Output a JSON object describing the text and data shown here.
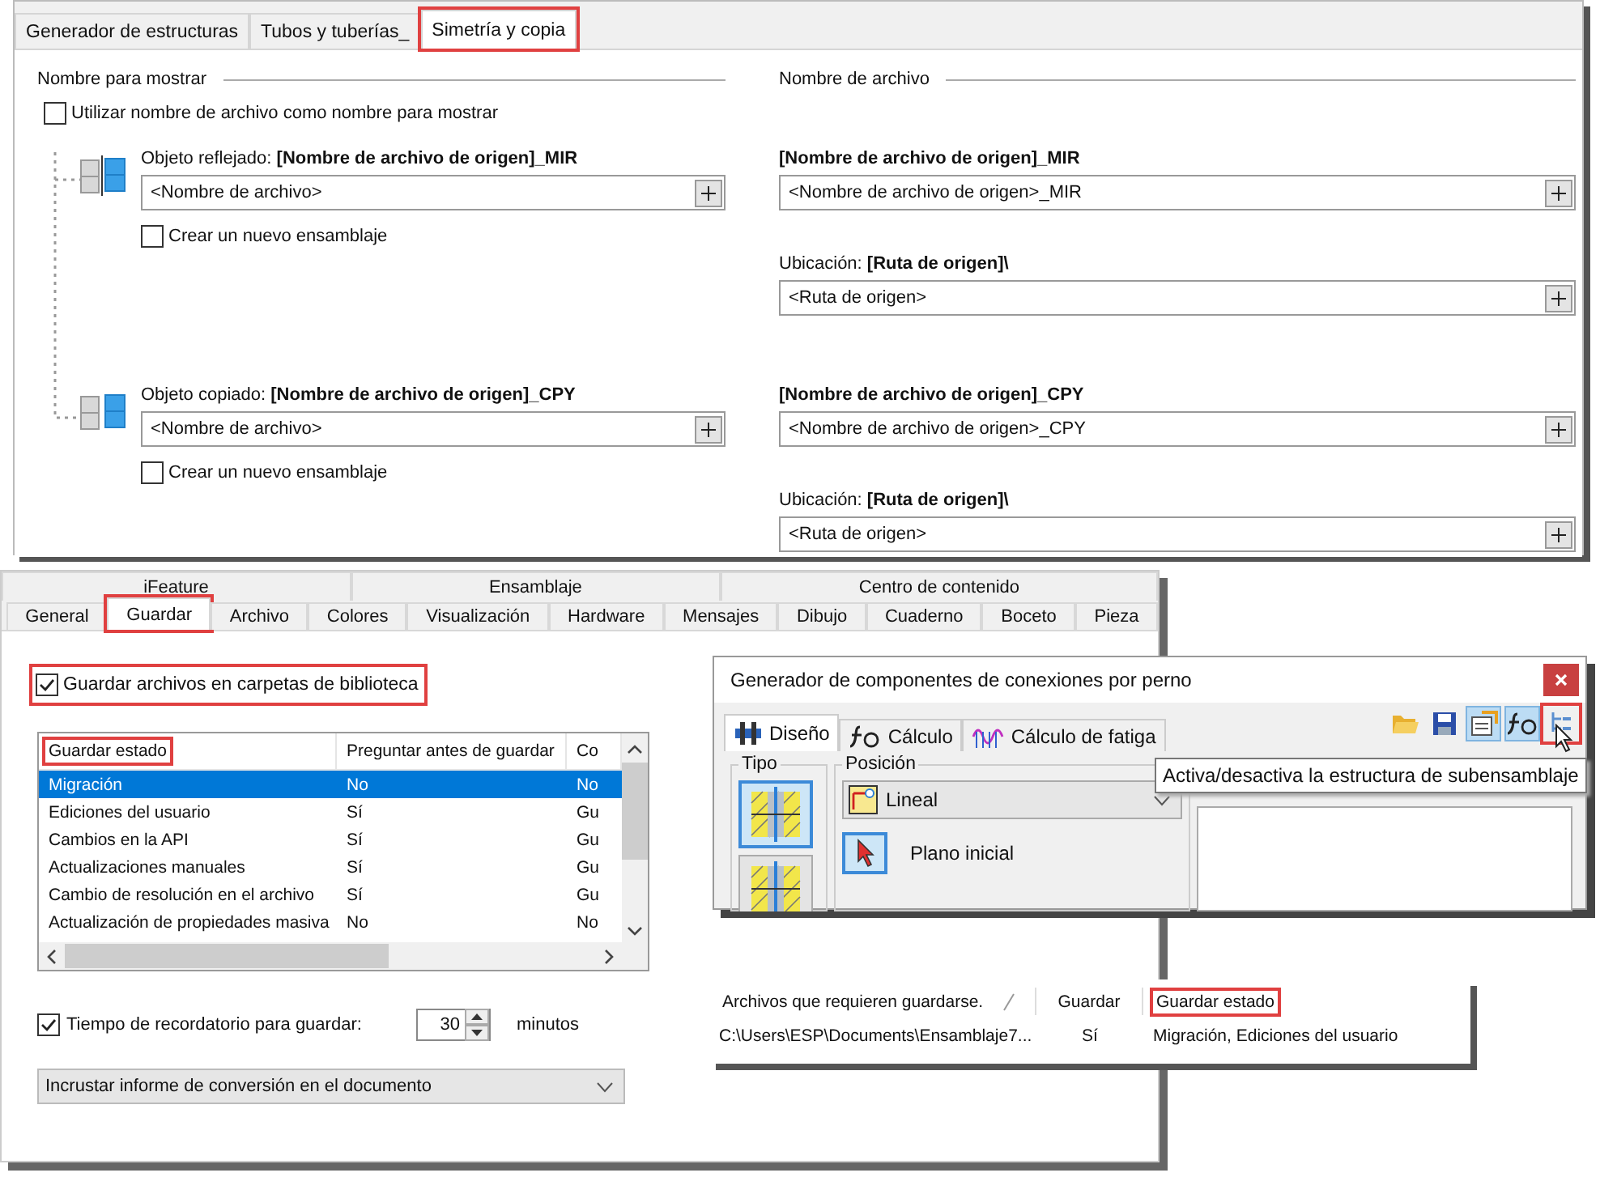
{
  "mirror_panel": {
    "tabs": [
      {
        "label": "Generador de estructuras",
        "selected": false,
        "highlighted": false
      },
      {
        "label": "Tubos y tuberías_",
        "selected": false,
        "highlighted": false
      },
      {
        "label": "Simetría y copia",
        "selected": true,
        "highlighted": true
      }
    ],
    "display_name": {
      "heading": "Nombre para mostrar",
      "use_filename": {
        "label": "Utilizar nombre de archivo como nombre para mostrar",
        "checked": false
      },
      "objects": [
        {
          "label": "Objeto reflejado: **[Nombre de archivo de origen]_MIR**",
          "value": "<Nombre de archivo>",
          "new_assembly": {
            "label": "Crear un nuevo ensamblaje",
            "checked": false
          }
        },
        {
          "label": "Objeto copiado: **[Nombre de archivo de origen]_CPY**",
          "value": "<Nombre de archivo>",
          "new_assembly": {
            "label": "Crear un nuevo ensamblaje",
            "checked": false
          }
        }
      ]
    },
    "file_name": {
      "heading": "Nombre de archivo",
      "groups": [
        {
          "name_label": "[Nombre de archivo de origen]_MIR",
          "name_value": "<Nombre de archivo de origen>_MIR",
          "location_label": "Ubicación: **[Ruta de origen]\\**",
          "location_value": "<Ruta de origen>"
        },
        {
          "name_label": "[Nombre de archivo de origen]_CPY",
          "name_value": "<Nombre de archivo de origen>_CPY",
          "location_label": "Ubicación: **[Ruta de origen]\\**",
          "location_value": "<Ruta de origen>"
        }
      ]
    }
  },
  "options_panel": {
    "group_tabs": [
      {
        "label": "iFeature"
      },
      {
        "label": "Ensamblaje"
      },
      {
        "label": "Centro de contenido"
      }
    ],
    "tabs": [
      {
        "label": "General",
        "selected": false,
        "highlighted": false
      },
      {
        "label": "Guardar",
        "selected": true,
        "highlighted": true
      },
      {
        "label": "Archivo",
        "selected": false,
        "highlighted": false
      },
      {
        "label": "Colores",
        "selected": false,
        "highlighted": false
      },
      {
        "label": "Visualización",
        "selected": false,
        "highlighted": false
      },
      {
        "label": "Hardware",
        "selected": false,
        "highlighted": false
      },
      {
        "label": "Mensajes",
        "selected": false,
        "highlighted": false
      },
      {
        "label": "Dibujo",
        "selected": false,
        "highlighted": false
      },
      {
        "label": "Cuaderno",
        "selected": false,
        "highlighted": false
      },
      {
        "label": "Boceto",
        "selected": false,
        "highlighted": false
      },
      {
        "label": "Pieza",
        "selected": false,
        "highlighted": false
      }
    ],
    "library_folders": {
      "label": "Guardar archivos en carpetas de biblioteca",
      "checked": true,
      "highlighted": true
    },
    "table": {
      "columns": [
        {
          "label": "Guardar estado",
          "highlighted": true
        },
        {
          "label": "Preguntar antes de guardar",
          "highlighted": false
        },
        {
          "label": "Co",
          "highlighted": false
        }
      ],
      "rows": [
        {
          "cells": [
            "Migración",
            "No",
            "No"
          ],
          "selected": true
        },
        {
          "cells": [
            "Ediciones del usuario",
            "Sí",
            "Gu"
          ],
          "selected": false
        },
        {
          "cells": [
            "Cambios en la API",
            "Sí",
            "Gu"
          ],
          "selected": false
        },
        {
          "cells": [
            "Actualizaciones manuales",
            "Sí",
            "Gu"
          ],
          "selected": false
        },
        {
          "cells": [
            "Cambio de resolución en el archivo",
            "Sí",
            "Gu"
          ],
          "selected": false
        },
        {
          "cells": [
            "Actualización de propiedades masiva",
            "No",
            "No"
          ],
          "selected": false
        }
      ]
    },
    "reminder": {
      "label": "Tiempo de recordatorio para guardar:",
      "checked": true,
      "value": "30",
      "unit": "minutos"
    },
    "conversion_report": {
      "value": "Incrustar informe de conversión en el documento"
    }
  },
  "bolt_dialog": {
    "title": "Generador de componentes de conexiones por perno",
    "tabs": [
      {
        "label": "Diseño",
        "selected": true
      },
      {
        "label": "Cálculo",
        "selected": false
      },
      {
        "label": "Cálculo de fatiga",
        "selected": false
      }
    ],
    "toolbar": [
      {
        "pressed": false,
        "highlighted": false
      },
      {
        "pressed": false,
        "highlighted": false
      },
      {
        "pressed": true,
        "highlighted": false
      },
      {
        "pressed": true,
        "highlighted": false
      },
      {
        "pressed": false,
        "highlighted": true
      }
    ],
    "type_group": {
      "label": "Tipo",
      "options": [
        {
          "selected": true
        },
        {
          "selected": false
        }
      ]
    },
    "position_group": {
      "label": "Posición",
      "dropdown": "Lineal",
      "start_plane": "Plano inicial"
    },
    "tooltip": "Activa/desactiva la estructura de subensamblaje"
  },
  "save_popup": {
    "columns": [
      {
        "label": "Archivos que requieren guardarse.",
        "highlighted": false
      },
      {
        "label": "Guardar",
        "highlighted": false
      },
      {
        "label": "Guardar estado",
        "highlighted": true
      }
    ],
    "rows": [
      {
        "cells": [
          "C:\\Users\\ESP\\Documents\\Ensamblaje7...",
          "Sí",
          "Migración,  Ediciones del usuario"
        ]
      }
    ]
  }
}
